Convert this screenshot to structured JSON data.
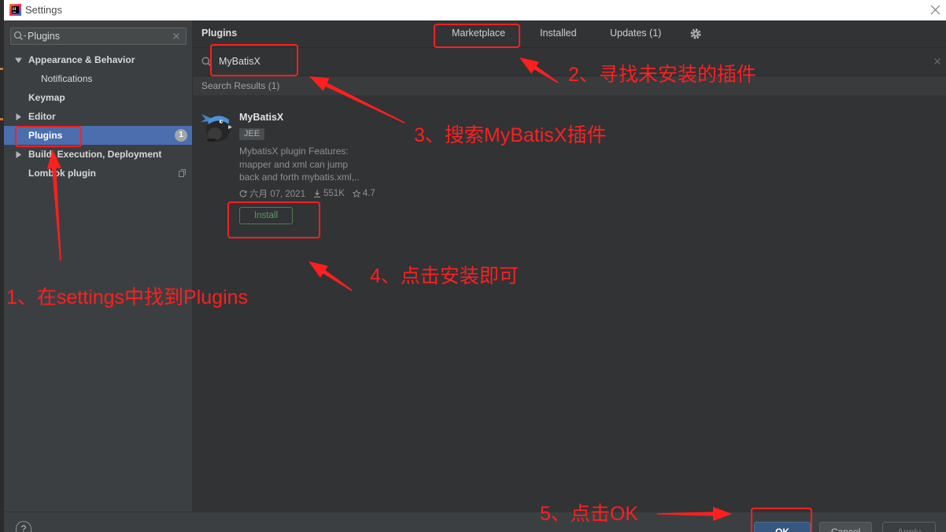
{
  "window": {
    "title": "Settings"
  },
  "sidebar": {
    "search": {
      "value": "Plugins"
    },
    "items": [
      {
        "label": "Appearance & Behavior",
        "expanded": true
      },
      {
        "label": "Notifications"
      },
      {
        "label": "Keymap"
      },
      {
        "label": "Editor",
        "expanded": false
      },
      {
        "label": "Plugins",
        "badge": "1",
        "selected": true
      },
      {
        "label": "Build, Execution, Deployment",
        "expanded": false
      },
      {
        "label": "Lombok plugin"
      }
    ]
  },
  "main": {
    "title": "Plugins",
    "tabs": [
      {
        "label": "Marketplace",
        "active": true
      },
      {
        "label": "Installed"
      },
      {
        "label": "Updates (1)"
      }
    ],
    "search": {
      "value": "MyBatisX"
    },
    "results_header": "Search Results (1)",
    "plugin": {
      "name": "MyBatisX",
      "tag": "JEE",
      "description": [
        "MybatisX plugin Features:",
        "mapper and xml can jump",
        "back and forth mybatis.xml,.."
      ],
      "date": "六月 07, 2021",
      "downloads": "551K",
      "rating": "4.7",
      "install_label": "Install"
    }
  },
  "footer": {
    "help": "?",
    "ok": "OK",
    "cancel": "Cancel",
    "apply": "Apply"
  },
  "annotations": {
    "step1": "1、在settings中找到Plugins",
    "step2": "2、寻找未安装的插件",
    "step3": "3、搜索MyBatisX插件",
    "step4": "4、点击安装即可",
    "step5": "5、点击OK"
  },
  "colors": {
    "accent_red": "#ff1f1f",
    "selection": "#4b6eaf",
    "install_green": "#5c9e5f",
    "ok_blue": "#365880"
  }
}
